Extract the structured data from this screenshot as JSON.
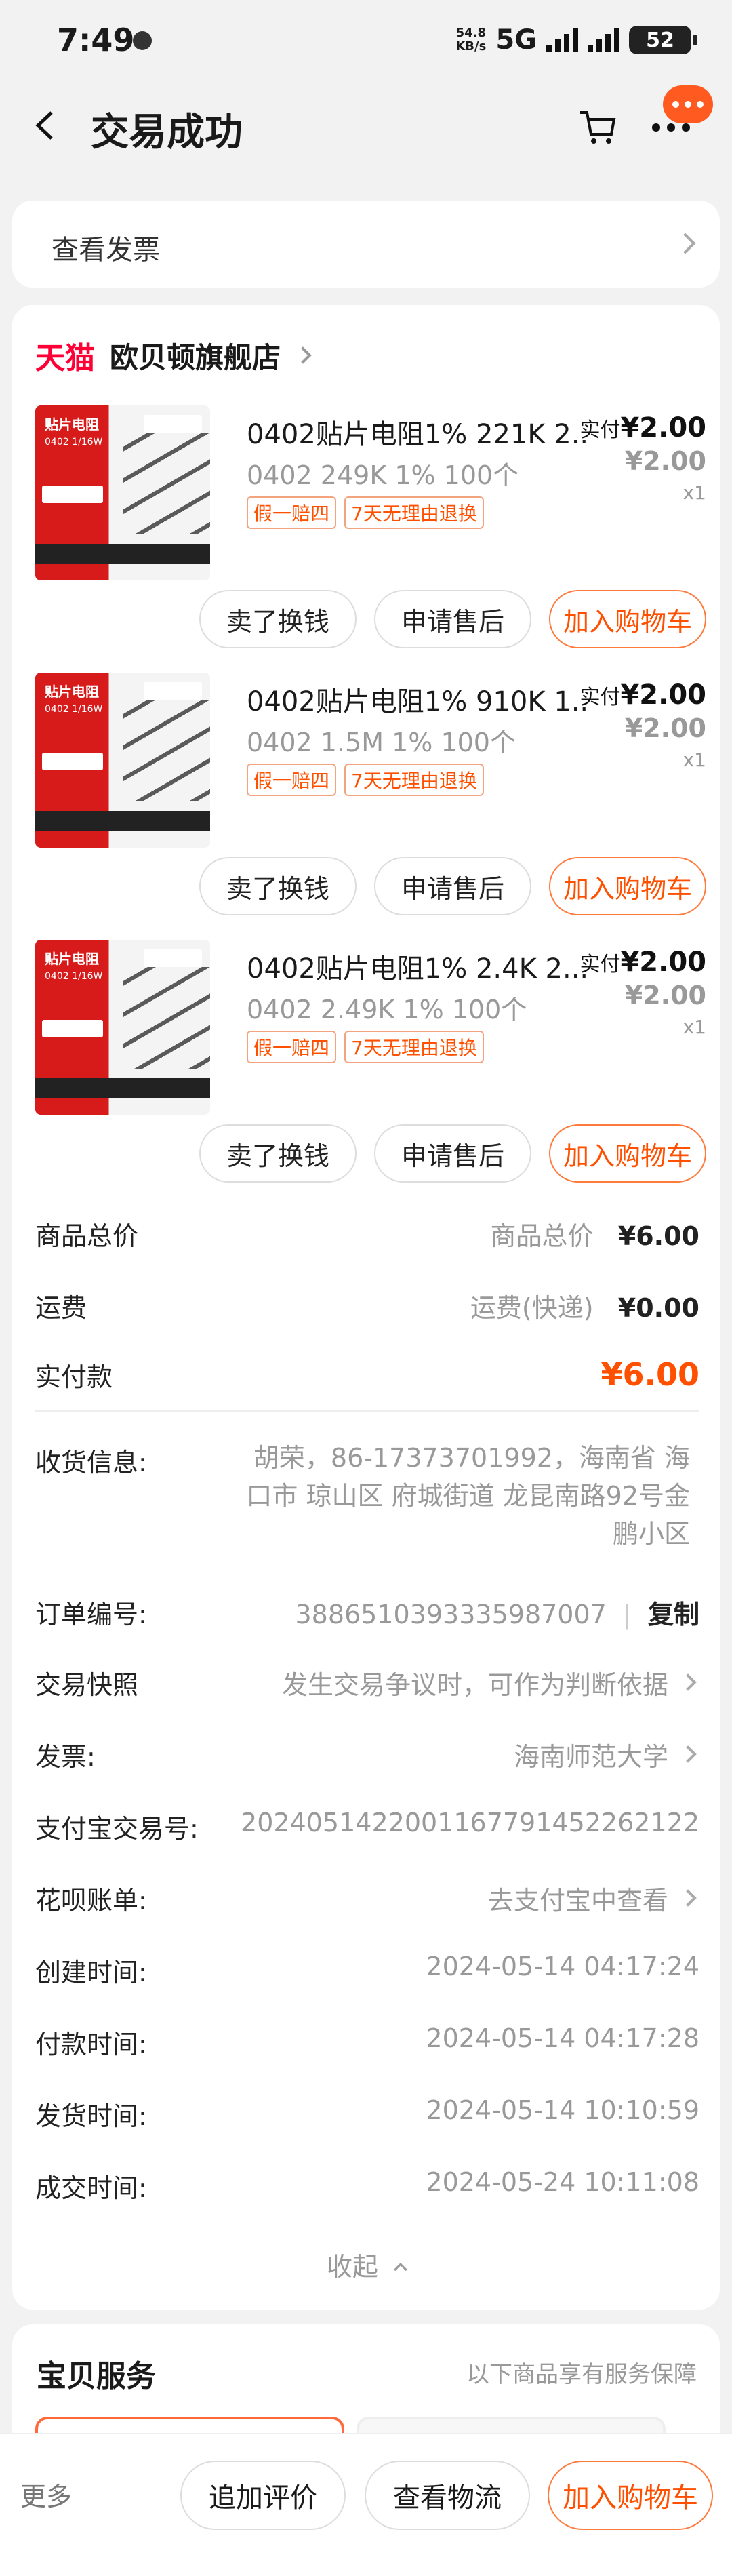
{
  "status_bar": {
    "time": "7:49",
    "net_speed_value": "54.8",
    "net_speed_unit": "KB/s",
    "network": "5G",
    "battery": "52"
  },
  "header": {
    "title": "交易成功",
    "back_icon": "chevron-left-icon",
    "cart_icon": "cart-icon",
    "more_icon": "more-icon"
  },
  "invoice": {
    "label": "查看发票"
  },
  "shop": {
    "platform": "天猫",
    "name": "欧贝顿旗舰店"
  },
  "items": [
    {
      "title": "0402贴片电阻1% 221K 2...",
      "spec": "0402 249K 1% 100个",
      "tags": [
        "假一赔四",
        "7天无理由退换"
      ],
      "paid_label": "实付",
      "paid": "¥2.00",
      "price": "¥2.00",
      "qty": "x1",
      "thumb": {
        "title": "贴片电阻",
        "sub": "0402 1/16W"
      },
      "actions": [
        "卖了换钱",
        "申请售后",
        "加入购物车"
      ]
    },
    {
      "title": "0402贴片电阻1% 910K 1...",
      "spec": "0402 1.5M 1% 100个",
      "tags": [
        "假一赔四",
        "7天无理由退换"
      ],
      "paid_label": "实付",
      "paid": "¥2.00",
      "price": "¥2.00",
      "qty": "x1",
      "thumb": {
        "title": "贴片电阻",
        "sub": "0402 1/16W"
      },
      "actions": [
        "卖了换钱",
        "申请售后",
        "加入购物车"
      ]
    },
    {
      "title": "0402贴片电阻1% 2.4K 2....",
      "spec": "0402 2.49K 1% 100个",
      "tags": [
        "假一赔四",
        "7天无理由退换"
      ],
      "paid_label": "实付",
      "paid": "¥2.00",
      "price": "¥2.00",
      "qty": "x1",
      "thumb": {
        "title": "贴片电阻",
        "sub": "0402 1/16W"
      },
      "actions": [
        "卖了换钱",
        "申请售后",
        "加入购物车"
      ]
    }
  ],
  "summary": {
    "total_label": "商品总价",
    "total_sub": "商品总价",
    "total_value": "¥6.00",
    "shipping_label": "运费",
    "shipping_sub": "运费(快递)",
    "shipping_value": "¥0.00",
    "paid_label": "实付款",
    "paid_value": "¥6.00"
  },
  "details": {
    "address_label": "收货信息:",
    "address_value": "胡荣，86-17373701992，海南省 海口市 琼山区 府城街道 龙昆南路92号金鹏小区",
    "order_no_label": "订单编号:",
    "order_no": "3886510393335987007",
    "copy": "复制",
    "snapshot_label": "交易快照",
    "snapshot_value": "发生交易争议时，可作为判断依据",
    "invoice_label": "发票:",
    "invoice_value": "海南师范大学",
    "alipay_label": "支付宝交易号:",
    "alipay_value": "2024051422001167791452262122",
    "huabei_label": "花呗账单:",
    "huabei_value": "去支付宝中查看",
    "created_label": "创建时间:",
    "created_value": "2024-05-14 04:17:24",
    "paid_label": "付款时间:",
    "paid_value": "2024-05-14 04:17:28",
    "shipped_label": "发货时间:",
    "shipped_value": "2024-05-14 10:10:59",
    "completed_label": "成交时间:",
    "completed_value": "2024-05-24 10:11:08",
    "collapse": "收起"
  },
  "service": {
    "title": "宝贝服务",
    "note": "以下商品享有服务保障"
  },
  "bottom_bar": {
    "more": "更多",
    "review": "追加评价",
    "logistics": "查看物流",
    "add_cart": "加入购物车"
  },
  "colors": {
    "accent": "#ff5000",
    "tmall_red": "#ff0036",
    "background": "#f2f2f2"
  }
}
